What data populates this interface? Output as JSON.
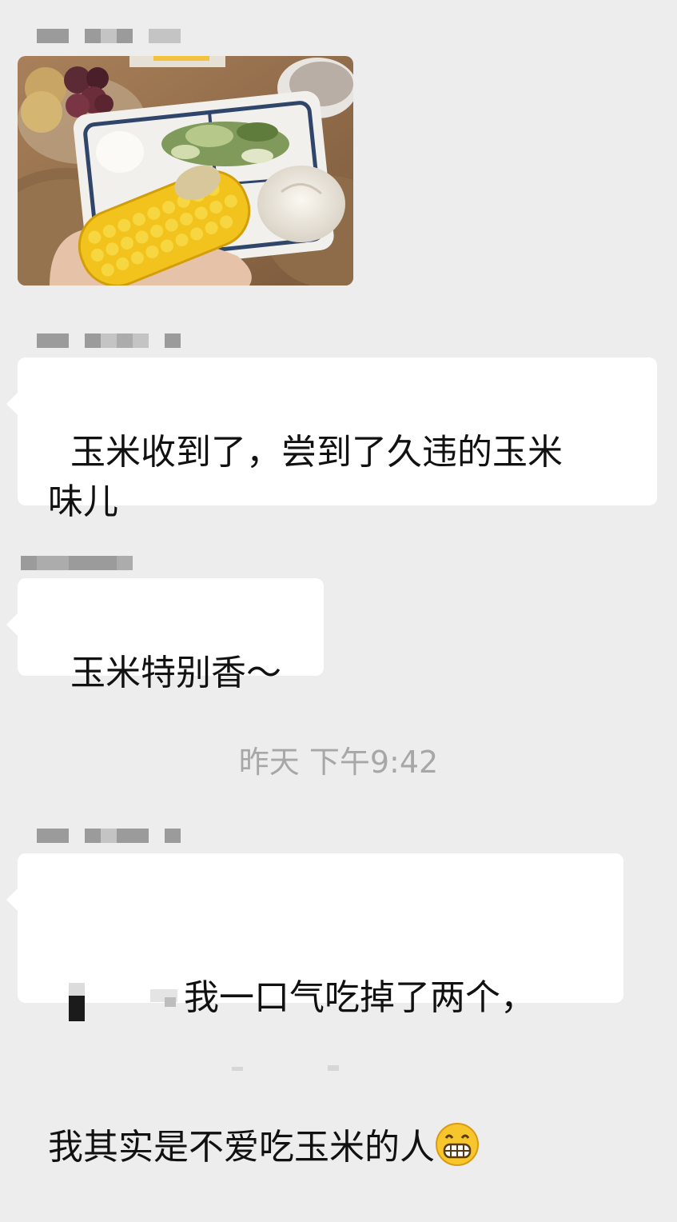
{
  "messages": [
    {
      "type": "image"
    },
    {
      "type": "text",
      "text": "玉米收到了，尝到了久违的玉米\n味儿"
    },
    {
      "type": "text",
      "text": "玉米特别香～"
    },
    {
      "type": "text",
      "text_line1": "我一口气吃掉了两个，",
      "text_line2": "我其实是不爱吃玉米的人"
    }
  ],
  "timestamp": "昨天 下午9:42",
  "icons": {
    "emoji": "grinning-face-icon"
  },
  "colors": {
    "background": "#ededed",
    "bubble": "#ffffff",
    "timestamp": "#a7a7a7"
  }
}
